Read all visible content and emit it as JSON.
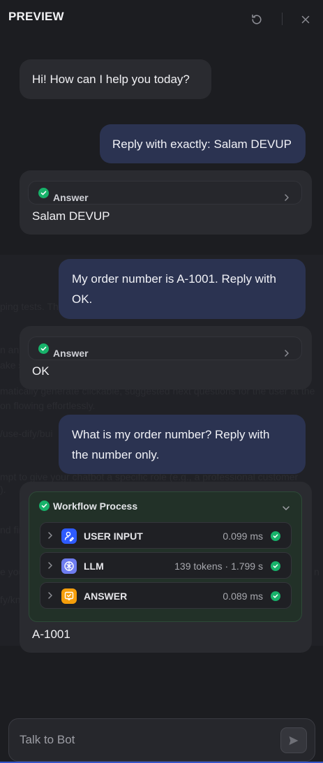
{
  "header": {
    "title": "PREVIEW",
    "icons": [
      "refresh-icon",
      "close-icon"
    ]
  },
  "messages": [
    {
      "role": "bot",
      "text": "Hi! How can I help you today?"
    },
    {
      "role": "user",
      "text": "Reply with exactly: Salam DEVUP"
    },
    {
      "role": "bot",
      "status_label": "Answer",
      "text": "Salam DEVUP"
    },
    {
      "role": "user",
      "line1": "My order number is A-1001. Reply with",
      "line2": "OK."
    },
    {
      "role": "bot",
      "status_label": "Answer",
      "text": "OK"
    },
    {
      "role": "user",
      "line1": "What is my order number? Reply with",
      "line2": "the number only."
    },
    {
      "role": "bot",
      "workflow": {
        "title": "Workflow Process",
        "nodes": [
          {
            "label": "USER INPUT",
            "meta": "0.099 ms",
            "icon": "user-input-icon",
            "color": "#2e5bff"
          },
          {
            "label": "LLM",
            "meta": "139 tokens · 1.799 s",
            "icon": "llm-icon",
            "color": "#6e7cf0"
          },
          {
            "label": "ANSWER",
            "meta": "0.089 ms",
            "icon": "answer-icon",
            "color": "#f59e0b"
          }
        ]
      },
      "text": "A-1001"
    }
  ],
  "background_ghost": {
    "l1": "ping tests. Th",
    "l2": "n an",
    "l3": "ake s",
    "l4": "matically generate clickable, suggested next questions for the user at the",
    "l5": "on flowing effortlessly.",
    "l6": "/use-dify/bui",
    "l7": "mpt to give your chatbot a specific role (e.g., a professional customer",
    "l8": ").",
    "l9": "nd fin",
    "l10": "e you",
    "l11": "n",
    "l12": "fy/kn"
  },
  "input": {
    "placeholder": "Talk to Bot",
    "value": ""
  },
  "colors": {
    "accent": "#3654c9",
    "success": "#17b26a",
    "user_bubble": "#2b3351",
    "bot_bubble": "#2a2b30"
  }
}
